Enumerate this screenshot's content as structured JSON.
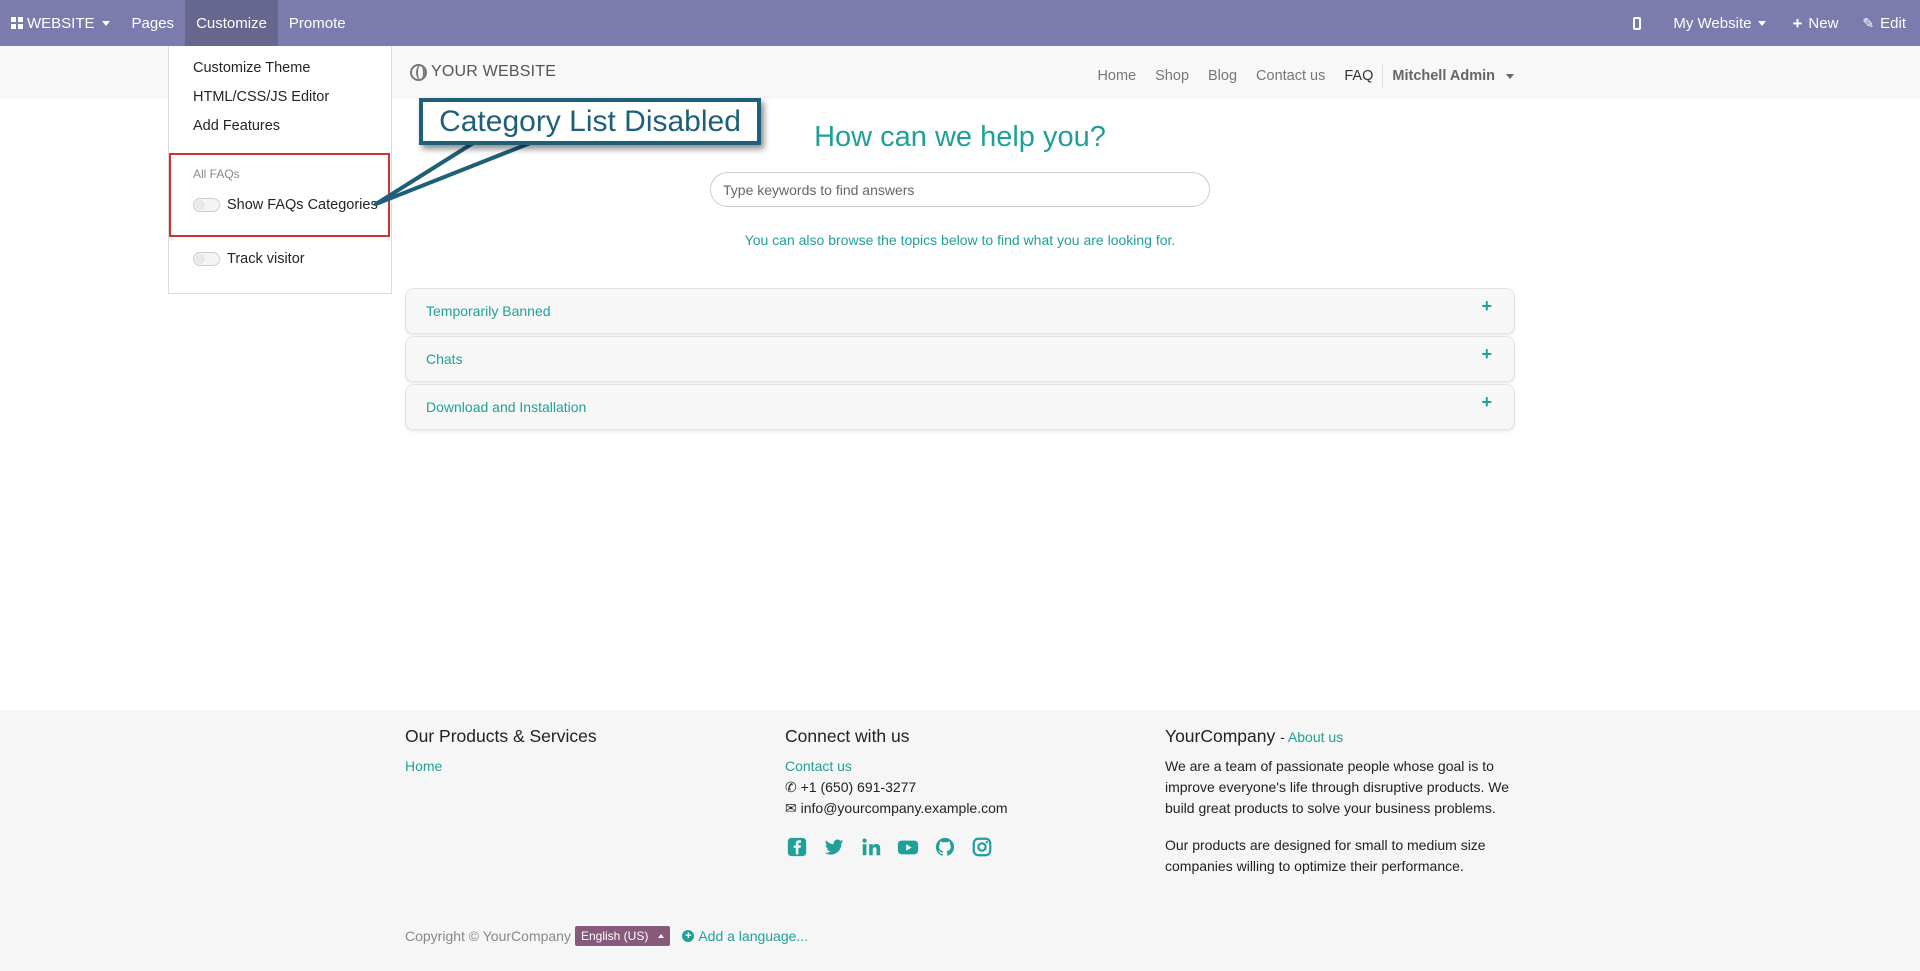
{
  "topbar": {
    "app_label": "WEBSITE",
    "menu": [
      "Pages",
      "Customize",
      "Promote"
    ],
    "website_selector": "My Website",
    "new_label": "New",
    "edit_label": "Edit"
  },
  "site_header": {
    "logo_text": "YOUR WEBSITE",
    "nav": [
      "Home",
      "Shop",
      "Blog",
      "Contact us",
      "FAQ"
    ],
    "active_nav": "FAQ",
    "user": "Mitchell Admin"
  },
  "customize_menu": {
    "items": [
      "Customize Theme",
      "HTML/CSS/JS Editor",
      "Add Features"
    ],
    "section_header": "All FAQs",
    "toggle_faq_categories": "Show FAQs Categories",
    "toggle_track_visitor": "Track visitor"
  },
  "annotation": {
    "callout_text": "Category List Disabled",
    "box_color": "#d32f2f",
    "callout_color": "#1e5f7a"
  },
  "main": {
    "title": "How can we help you?",
    "search_placeholder": "Type keywords to find answers",
    "browse_text": "You can also browse the topics below to find what you are looking for.",
    "faqs": [
      "Temporarily Banned",
      "Chats",
      "Download and Installation"
    ]
  },
  "footer": {
    "col1_title": "Our Products & Services",
    "col1_link": "Home",
    "col2_title": "Connect with us",
    "col2_contact": "Contact us",
    "phone": "+1 (650) 691-3277",
    "email": "info@yourcompany.example.com",
    "socials": [
      "facebook-icon",
      "twitter-icon",
      "linkedin-icon",
      "youtube-icon",
      "github-icon",
      "instagram-icon"
    ],
    "col3_title": "YourCompany",
    "col3_link": "About us",
    "about_p1": "We are a team of passionate people whose goal is to improve everyone's life through disruptive products. We build great products to solve your business problems.",
    "about_p2": "Our products are designed for small to medium size companies willing to optimize their performance.",
    "copyright": "Copyright © YourCompany",
    "language": "English (US)",
    "add_language": "Add a language..."
  },
  "colors": {
    "topbar": "#7c7bad",
    "accent_teal": "#20a09a",
    "language_button": "#875a7b"
  }
}
